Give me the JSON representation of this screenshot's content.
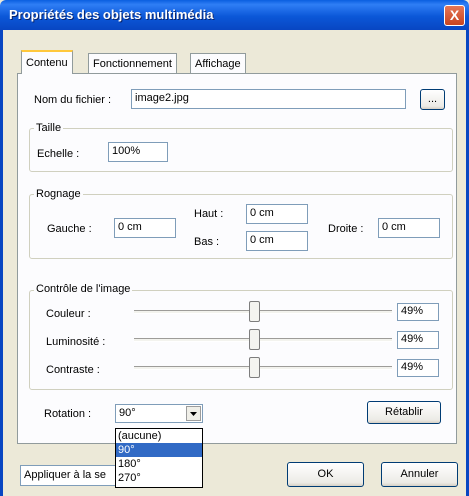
{
  "window": {
    "title": "Propriétés des objets multimédia",
    "close_glyph": "X"
  },
  "tabs": [
    "Contenu",
    "Fonctionnement",
    "Affichage"
  ],
  "file": {
    "label": "Nom du fichier :",
    "value": "image2.jpg",
    "browse_label": "..."
  },
  "taille": {
    "legend": "Taille",
    "echelle_label": "Echelle :",
    "echelle_value": "100%"
  },
  "rognage": {
    "legend": "Rognage",
    "gauche_label": "Gauche :",
    "gauche_value": "0 cm",
    "haut_label": "Haut :",
    "haut_value": "0 cm",
    "bas_label": "Bas :",
    "bas_value": "0 cm",
    "droite_label": "Droite :",
    "droite_value": "0 cm"
  },
  "controle": {
    "legend": "Contrôle de l'image",
    "sliders": [
      {
        "label": "Couleur :",
        "value": "49%"
      },
      {
        "label": "Luminosité :",
        "value": "49%"
      },
      {
        "label": "Contraste :",
        "value": "49%"
      }
    ]
  },
  "rotation": {
    "label": "Rotation :",
    "selected": "90°",
    "options": [
      "(aucune)",
      "90°",
      "180°",
      "270°"
    ]
  },
  "buttons": {
    "reset": "Rétablir",
    "ok": "OK",
    "cancel": "Annuler"
  },
  "apply": {
    "value": "Appliquer à la se"
  }
}
